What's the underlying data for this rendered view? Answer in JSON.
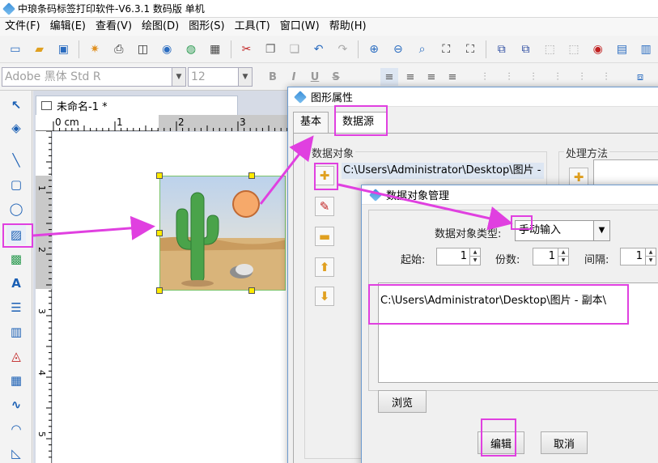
{
  "window": {
    "title": "中琅条码标签打印软件-V6.3.1 数码版 单机"
  },
  "menu": [
    "文件(F)",
    "编辑(E)",
    "查看(V)",
    "绘图(D)",
    "图形(S)",
    "工具(T)",
    "窗口(W)",
    "帮助(H)"
  ],
  "fontbar": {
    "font_name": "Adobe 黑体 Std R",
    "font_size": "12"
  },
  "document": {
    "tab_title": "未命名-1 *",
    "ruler_top": [
      "0 cm",
      "1",
      "2",
      "3"
    ],
    "ruler_left": [
      "1",
      "2",
      "3",
      "4",
      "5"
    ]
  },
  "prop_dialog": {
    "title": "图形属性",
    "tabs": [
      "基本",
      "数据源"
    ],
    "data_objects_label": "数据对象",
    "data_object_item": "C:\\Users\\Administrator\\Desktop\\图片 -",
    "process_label": "处理方法"
  },
  "manager_dialog": {
    "title": "数据对象管理",
    "type_label": "数据对象类型:",
    "type_value": "手动输入",
    "start_label": "起始:",
    "start_value": "1",
    "copies_label": "份数:",
    "copies_value": "1",
    "interval_label": "间隔:",
    "interval_value": "1",
    "text_value": "C:\\Users\\Administrator\\Desktop\\图片 - 副本\\",
    "browse_label": "浏览",
    "edit_label": "编辑",
    "cancel_label": "取消"
  }
}
